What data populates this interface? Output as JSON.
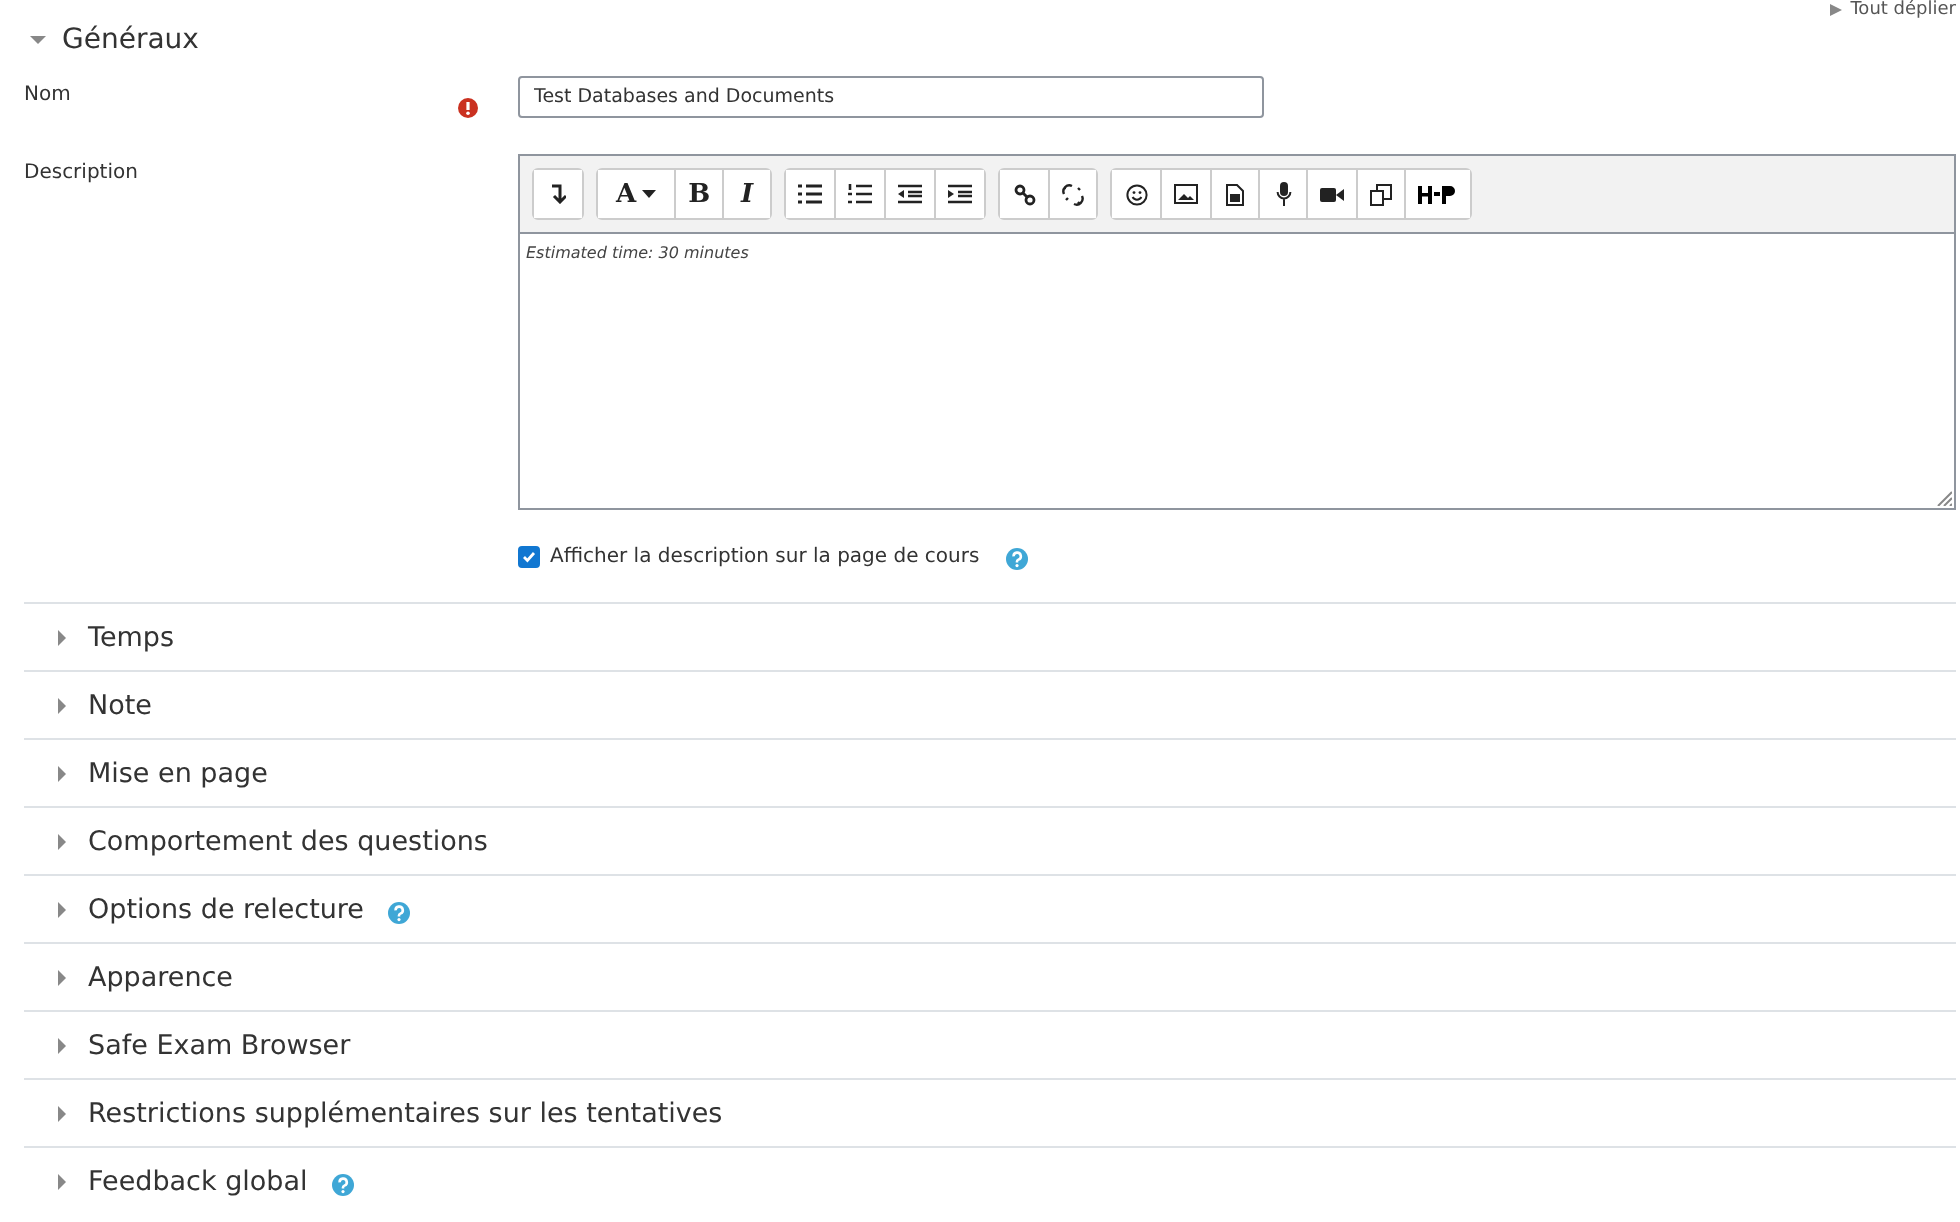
{
  "expand_all": "Tout déplier",
  "general": {
    "title": "Généraux",
    "expanded": true,
    "name_field": {
      "label": "Nom",
      "required": true,
      "value": "Test Databases and Documents"
    },
    "description": {
      "label": "Description",
      "toolbar": [
        [
          {
            "kind": "collapse"
          }
        ],
        [
          {
            "kind": "font",
            "label": "A"
          },
          {
            "kind": "bold",
            "label": "B"
          },
          {
            "kind": "italic",
            "label": "I"
          }
        ],
        [
          {
            "kind": "bullets"
          },
          {
            "kind": "numbers"
          },
          {
            "kind": "outdent"
          },
          {
            "kind": "indent"
          }
        ],
        [
          {
            "kind": "link"
          },
          {
            "kind": "unlink"
          }
        ],
        [
          {
            "kind": "emoji"
          },
          {
            "kind": "image"
          },
          {
            "kind": "media"
          },
          {
            "kind": "mic"
          },
          {
            "kind": "video"
          },
          {
            "kind": "files"
          },
          {
            "kind": "h5p"
          }
        ]
      ],
      "content": "Estimated time: 30 minutes"
    },
    "show_description": {
      "label": "Afficher la description sur la page de cours",
      "checked": true,
      "help": true
    }
  },
  "sections": [
    {
      "title": "Temps",
      "expanded": false,
      "help": false
    },
    {
      "title": "Note",
      "expanded": false,
      "help": false
    },
    {
      "title": "Mise en page",
      "expanded": false,
      "help": false
    },
    {
      "title": "Comportement des questions",
      "expanded": false,
      "help": false
    },
    {
      "title": "Options de relecture",
      "expanded": false,
      "help": true
    },
    {
      "title": "Apparence",
      "expanded": false,
      "help": false
    },
    {
      "title": "Safe Exam Browser",
      "expanded": false,
      "help": false
    },
    {
      "title": "Restrictions supplémentaires sur les tentatives",
      "expanded": false,
      "help": false
    },
    {
      "title": "Feedback global",
      "expanded": false,
      "help": true
    }
  ]
}
